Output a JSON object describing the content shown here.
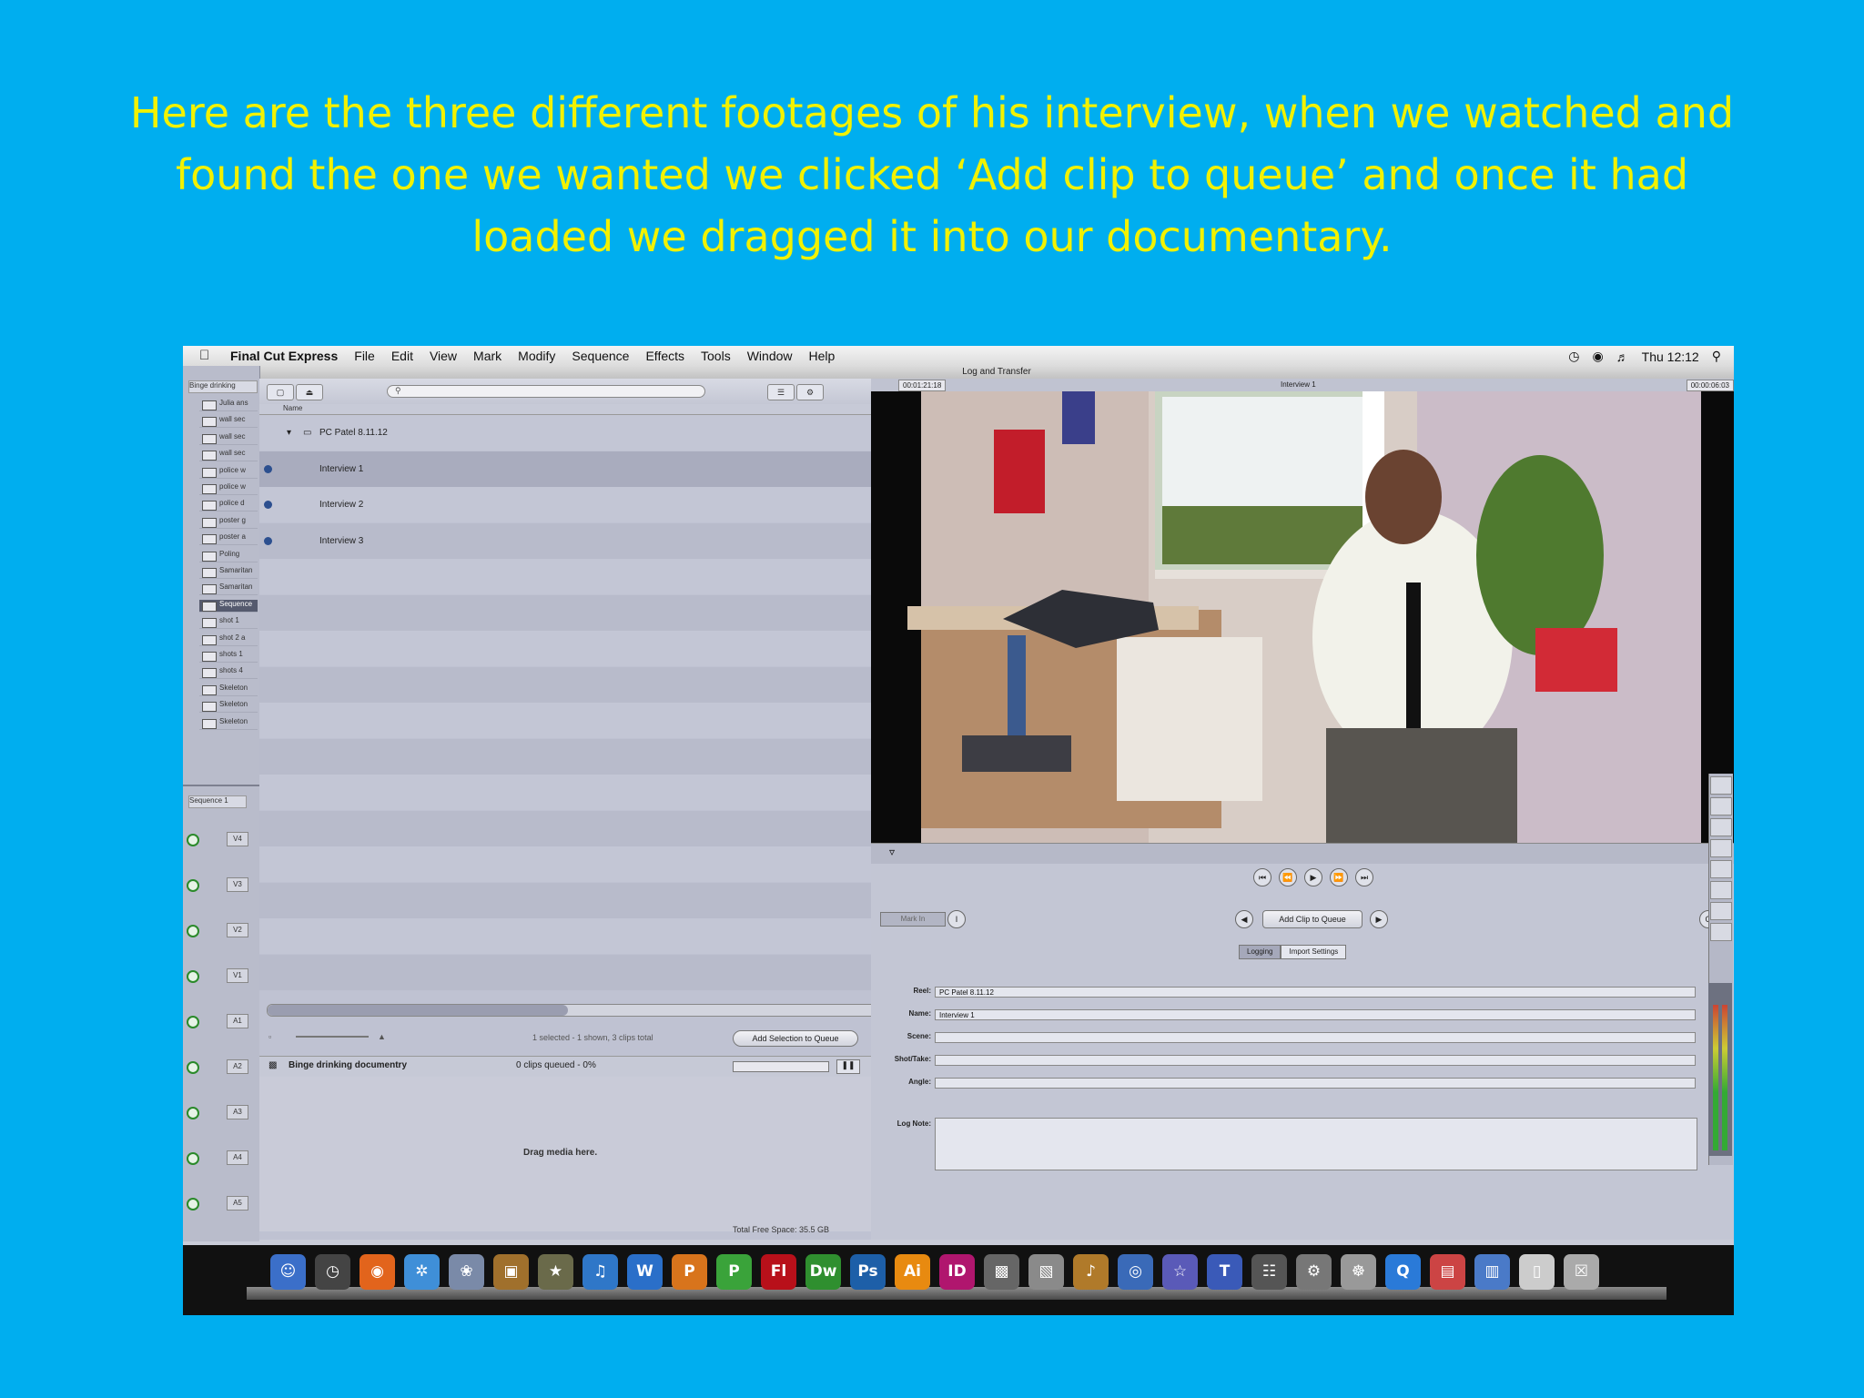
{
  "caption": [
    "Here are the three different footages of his interview, when we watched and",
    "found the one we wanted we clicked ‘Add clip to queue’ and once it had",
    "loaded we dragged it into our documentary."
  ],
  "menubar": {
    "app": "Final Cut Express",
    "items": [
      "File",
      "Edit",
      "View",
      "Mark",
      "Modify",
      "Sequence",
      "Effects",
      "Tools",
      "Window",
      "Help"
    ],
    "clock": "Thu 12:12"
  },
  "window_title": "Log and Transfer",
  "sidebar": {
    "tab": "Binge drinking",
    "items": [
      "Julia ans",
      "wall sec",
      "wall sec",
      "wall sec",
      "police w",
      "police w",
      "police d",
      "poster g",
      "poster a",
      "Poling",
      "Samaritan",
      "Samaritan",
      "Sequence",
      "shot 1",
      "shot 2 a",
      "shots 1",
      "shots 4",
      "Skeleton",
      "Skeleton",
      "Skeleton"
    ],
    "selected_index": 12
  },
  "timeline": {
    "tab": "Sequence 1",
    "tracks": [
      "V4",
      "V3",
      "V2",
      "V1",
      "A1",
      "A2",
      "A3",
      "A4",
      "A5"
    ]
  },
  "browser": {
    "column_name": "Name",
    "folder": "PC Patel 8.11.12",
    "clips": [
      "Interview 1",
      "Interview 2",
      "Interview 3"
    ],
    "status": "1 selected - 1 shown, 3 clips total",
    "add_selection_button": "Add Selection to Queue",
    "queue_name": "Binge drinking documentry",
    "queue_status": "0 clips queued - 0%",
    "drop_message": "Drag media here.",
    "free_space": "Total Free Space: 35.5 GB"
  },
  "viewer": {
    "timecode_left": "00:01:21:18",
    "clip_title": "Interview 1",
    "timecode_right": "00:00:06:03",
    "transport": [
      "⏮",
      "⏪",
      "▶",
      "⏩",
      "⏭"
    ],
    "set_in": "Mark In",
    "add_clip_button": "Add Clip to Queue",
    "tabs": [
      "Logging",
      "Import Settings"
    ],
    "fields": [
      {
        "label": "Reel:",
        "value": "PC Patel 8.11.12"
      },
      {
        "label": "Name:",
        "value": "Interview 1"
      },
      {
        "label": "Scene:",
        "value": ""
      },
      {
        "label": "Shot/Take:",
        "value": ""
      },
      {
        "label": "Angle:",
        "value": ""
      }
    ],
    "lognote_label": "Log Note:"
  },
  "dock": {
    "icons": [
      {
        "name": "finder-icon",
        "glyph": "☺",
        "color": "#3b6fc9"
      },
      {
        "name": "dashboard-icon",
        "glyph": "◷",
        "color": "#444"
      },
      {
        "name": "firefox-icon",
        "glyph": "◉",
        "color": "#e2641c"
      },
      {
        "name": "safari-icon",
        "glyph": "✲",
        "color": "#3f8fd8"
      },
      {
        "name": "iphoto-icon",
        "glyph": "❀",
        "color": "#7a8aa8"
      },
      {
        "name": "photo-icon",
        "glyph": "▣",
        "color": "#a0702c"
      },
      {
        "name": "star-icon",
        "glyph": "★",
        "color": "#6a6a4a"
      },
      {
        "name": "itunes-icon",
        "glyph": "♫",
        "color": "#2f77c8"
      },
      {
        "name": "word-icon",
        "glyph": "W",
        "color": "#2a6fc9"
      },
      {
        "name": "powerpoint-icon",
        "glyph": "P",
        "color": "#d8741c"
      },
      {
        "name": "publisher-icon",
        "glyph": "P",
        "color": "#3aa33a"
      },
      {
        "name": "flash-icon",
        "glyph": "Fl",
        "color": "#b8101a"
      },
      {
        "name": "dreamweaver-icon",
        "glyph": "Dw",
        "color": "#2f8f2f"
      },
      {
        "name": "photoshop-icon",
        "glyph": "Ps",
        "color": "#1d5fa8"
      },
      {
        "name": "illustrator-icon",
        "glyph": "Ai",
        "color": "#e88a10"
      },
      {
        "name": "indesign-icon",
        "glyph": "ID",
        "color": "#b0166e"
      },
      {
        "name": "camera-icon",
        "glyph": "▩",
        "color": "#666"
      },
      {
        "name": "preview-icon",
        "glyph": "▧",
        "color": "#8a8a8a"
      },
      {
        "name": "garageband-icon",
        "glyph": "♪",
        "color": "#b07a2a"
      },
      {
        "name": "dvd-icon",
        "glyph": "◎",
        "color": "#3a6ab8"
      },
      {
        "name": "idvd-icon",
        "glyph": "☆",
        "color": "#5a5ab8"
      },
      {
        "name": "livetype-icon",
        "glyph": "T",
        "color": "#3a5ab8"
      },
      {
        "name": "clapper-icon",
        "glyph": "☷",
        "color": "#555"
      },
      {
        "name": "script-icon",
        "glyph": "⚙",
        "color": "#777"
      },
      {
        "name": "compressor-icon",
        "glyph": "☸",
        "color": "#999"
      },
      {
        "name": "quicktime-icon",
        "glyph": "Q",
        "color": "#2a7ad8"
      },
      {
        "name": "calendar-icon",
        "glyph": "▤",
        "color": "#c44"
      },
      {
        "name": "stack-icon",
        "glyph": "▥",
        "color": "#4a7ac8"
      },
      {
        "name": "document-icon",
        "glyph": "▯",
        "color": "#ccc"
      },
      {
        "name": "trash-icon",
        "glyph": "☒",
        "color": "#aaa"
      }
    ]
  },
  "colors": {
    "background": "#00AEEF",
    "caption_text": "#F2F200"
  }
}
